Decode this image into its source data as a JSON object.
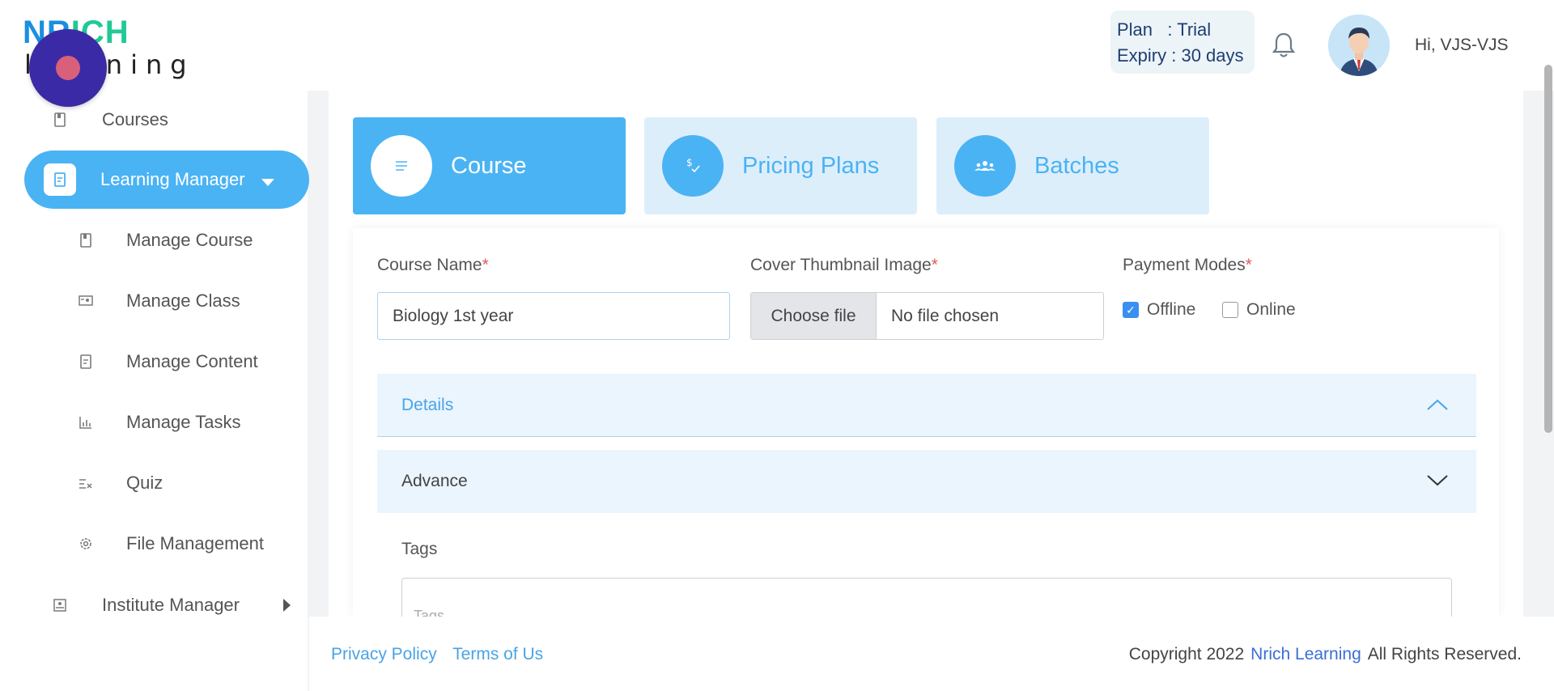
{
  "brand": {
    "logo_top_a": "NR",
    "logo_top_b": "ICH",
    "logo_bottom": "learning"
  },
  "header": {
    "plan_label": "Plan",
    "plan_value": ": Trial",
    "expiry_label": "Expiry",
    "expiry_value": ": 30 days",
    "greeting": "Hi, VJS-VJS"
  },
  "sidebar": {
    "courses": "Courses",
    "learning_manager": "Learning Manager",
    "items": [
      {
        "label": "Manage Course",
        "icon": "book-icon"
      },
      {
        "label": "Manage Class",
        "icon": "presentation-icon"
      },
      {
        "label": "Manage Content",
        "icon": "document-icon"
      },
      {
        "label": "Manage Tasks",
        "icon": "chart-icon"
      },
      {
        "label": "Quiz",
        "icon": "checklist-icon"
      },
      {
        "label": "File Management",
        "icon": "gear-icon"
      }
    ],
    "institute_manager": "Institute Manager"
  },
  "tabs": [
    {
      "label": "Course",
      "icon": "list-icon",
      "active": true
    },
    {
      "label": "Pricing Plans",
      "icon": "dollar-check-icon",
      "active": false
    },
    {
      "label": "Batches",
      "icon": "group-icon",
      "active": false
    }
  ],
  "form": {
    "course_name_label": "Course Name",
    "course_name_value": "Biology 1st year",
    "thumbnail_label": "Cover Thumbnail Image",
    "file_button": "Choose file",
    "file_status": "No file chosen",
    "payment_label": "Payment Modes",
    "offline_label": "Offline",
    "offline_checked": true,
    "online_label": "Online",
    "online_checked": false,
    "required_mark": "*",
    "details_label": "Details",
    "advance_label": "Advance",
    "tags_label": "Tags",
    "tags_placeholder": "Tags"
  },
  "footer": {
    "privacy": "Privacy Policy",
    "terms": "Terms of Us",
    "copyright_prefix": "Copyright 2022",
    "copyright_brand": "Nrich Learning",
    "copyright_suffix": "All Rights Reserved."
  },
  "colors": {
    "accent": "#4ab3f4",
    "accent_light": "#ddeefb",
    "record": "#3b2aa6"
  }
}
